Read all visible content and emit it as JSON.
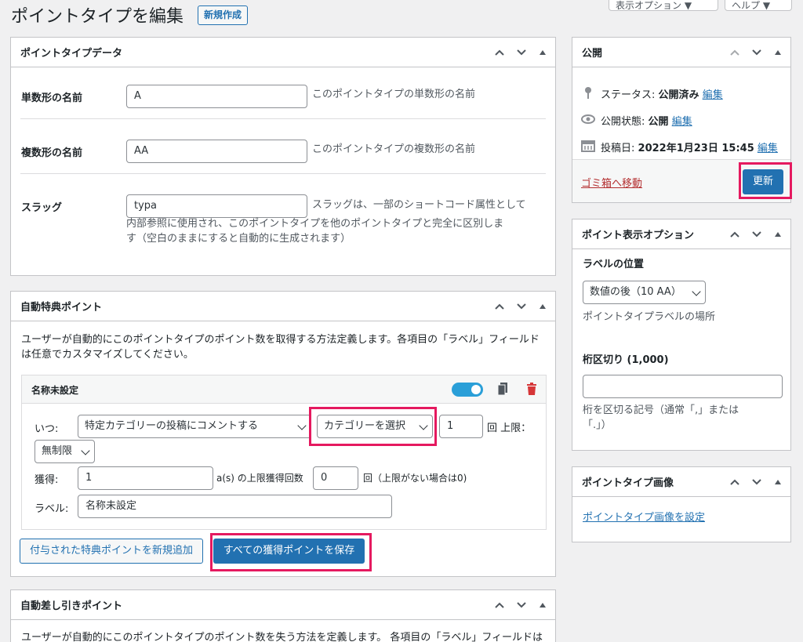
{
  "header": {
    "title": "ポイントタイプを編集",
    "new_button": "新規作成",
    "screen_options": "表示オプション ▼",
    "help": "ヘルプ ▼"
  },
  "point_type_data": {
    "title": "ポイントタイプデータ",
    "singular_label": "単数形の名前",
    "singular_value": "A",
    "singular_desc": "このポイントタイプの単数形の名前",
    "plural_label": "複数形の名前",
    "plural_value": "AA",
    "plural_desc": "このポイントタイプの複数形の名前",
    "slug_label": "スラッグ",
    "slug_value": "typa",
    "slug_desc_1": "スラッグは、一部のショートコード属性として",
    "slug_desc_2": "内部参照に使用され、このポイントタイプを他のポイントタイプと完全に区別しま",
    "slug_desc_3": "す（空白のままにすると自動的に生成されます）"
  },
  "auto_award": {
    "title": "自動特典ポイント",
    "desc_1": "ユーザーが自動的にこのポイントタイプのポイント数を取得する方法定義します。各項目の「ラベル」フィールド",
    "desc_2": "は任意でカスタマイズしてください。",
    "item_title": "名称未設定",
    "when_label": "いつ:",
    "when_select": "特定カテゴリーの投稿にコメントする",
    "category_select": "カテゴリーを選択",
    "times_value": "1",
    "times_suffix": "回 上限：",
    "limit_select": "無制限",
    "earn_label": "獲得:",
    "earn_value": "1",
    "earn_mid": "a(s) の上限獲得回数",
    "max_value": "0",
    "max_suffix": "回（上限がない場合は0)",
    "label_label": "ラベル:",
    "label_value": "名称未設定",
    "add_button": "付与された特典ポイントを新規追加",
    "save_button": "すべての獲得ポイントを保存"
  },
  "auto_deduct": {
    "title": "自動差し引きポイント",
    "desc_1": "ユーザーが自動的にこのポイントタイプのポイント数を失う方法を定義します。 各項目の「ラベル」フィールドは"
  },
  "publish": {
    "title": "公開",
    "status_label": "ステータス:",
    "status_value": "公開済み",
    "status_edit": "編集",
    "visibility_label": "公開状態:",
    "visibility_value": "公開",
    "visibility_edit": "編集",
    "date_label": "投稿日:",
    "date_value": "2022年1月23日 15:45",
    "date_edit": "編集",
    "trash": "ゴミ箱へ移動",
    "update": "更新"
  },
  "display_options": {
    "title": "ポイント表示オプション",
    "position_label": "ラベルの位置",
    "position_select": "数値の後（10 AA）",
    "position_desc": "ポイントタイプラベルの場所",
    "separator_label": "桁区切り (1,000)",
    "separator_value": "",
    "separator_desc_1": "桁を区切る記号（通常「,」または",
    "separator_desc_2": "「.」）"
  },
  "image_panel": {
    "title": "ポイントタイプ画像",
    "set_link": "ポイントタイプ画像を設定"
  },
  "colors": {
    "accent": "#2271b1",
    "highlight": "#e5195f",
    "toggle": "#2a9fd8",
    "trash": "#d63638"
  }
}
